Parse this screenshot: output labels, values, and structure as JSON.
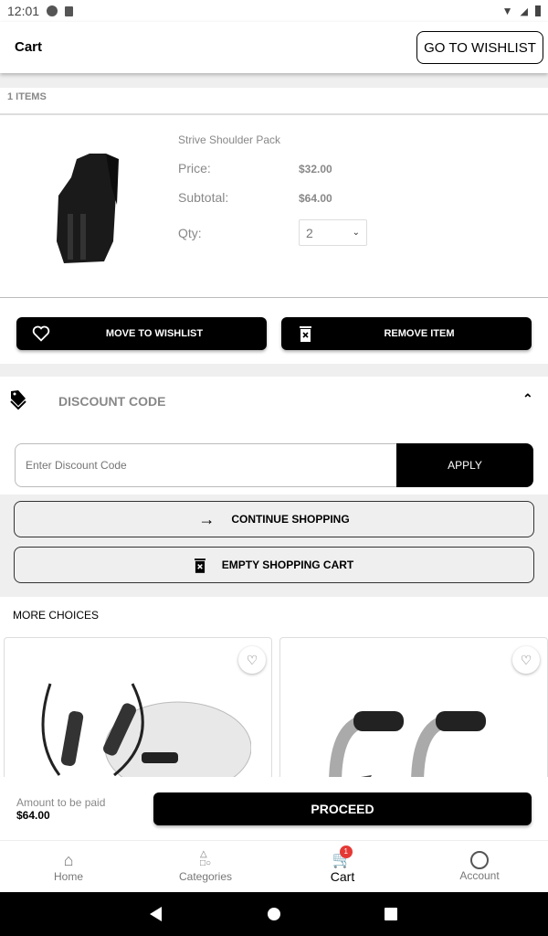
{
  "status": {
    "time": "12:01"
  },
  "header": {
    "title": "Cart",
    "wishlist_button": "GO TO WISHLIST"
  },
  "cart": {
    "items_count": "1 ITEMS",
    "item": {
      "name": "Strive Shoulder Pack",
      "price_label": "Price:",
      "price": "$32.00",
      "subtotal_label": "Subtotal:",
      "subtotal": "$64.00",
      "qty_label": "Qty:",
      "qty": "2"
    },
    "move_to_wishlist": "MOVE TO WISHLIST",
    "remove_item": "REMOVE ITEM"
  },
  "discount": {
    "title": "DISCOUNT CODE",
    "placeholder": "Enter Discount Code",
    "apply": "APPLY"
  },
  "actions": {
    "continue": "CONTINUE SHOPPING",
    "empty": "EMPTY SHOPPING CART"
  },
  "more": {
    "title": "MORE CHOICES"
  },
  "footer": {
    "amount_label": "Amount to be paid",
    "amount": "$64.00",
    "proceed": "PROCEED"
  },
  "nav": {
    "items": [
      {
        "label": "Home",
        "icon": "home-icon"
      },
      {
        "label": "Categories",
        "icon": "categories-icon"
      },
      {
        "label": "Cart",
        "icon": "cart-icon",
        "badge": "1"
      },
      {
        "label": "Account",
        "icon": "account-icon"
      }
    ]
  },
  "colors": {
    "badge": "#e53935",
    "accent": "#000000"
  }
}
